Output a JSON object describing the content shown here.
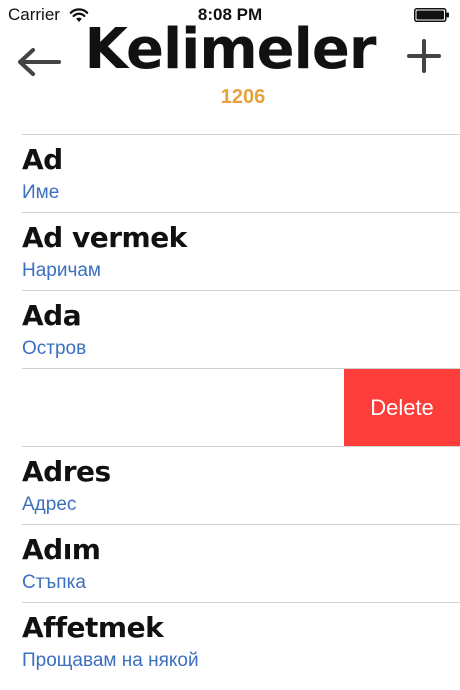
{
  "status_bar": {
    "carrier": "Carrier",
    "time": "8:08 PM",
    "wifi_icon": "wifi-icon",
    "battery_icon": "battery-icon"
  },
  "header": {
    "title": "Kelimeler",
    "count": "1206",
    "back_icon": "arrow-left-icon",
    "add_icon": "plus-icon",
    "accent_color": "#e6a23c"
  },
  "list": {
    "items": [
      {
        "word": "Ad",
        "translation": "Име"
      },
      {
        "word": "Ad vermek",
        "translation": "Наричам"
      },
      {
        "word": "Ada",
        "translation": "Остров"
      },
      {
        "word": "",
        "translation": "",
        "delete_label": "Delete"
      },
      {
        "word": "Adres",
        "translation": "Адрес"
      },
      {
        "word": "Adım",
        "translation": "Стъпка"
      },
      {
        "word": "Affetmek",
        "translation": "Прощавам на някой"
      }
    ],
    "word_color": "#111111",
    "translation_color": "#3b6fbf",
    "delete_color": "#fc3d39"
  }
}
